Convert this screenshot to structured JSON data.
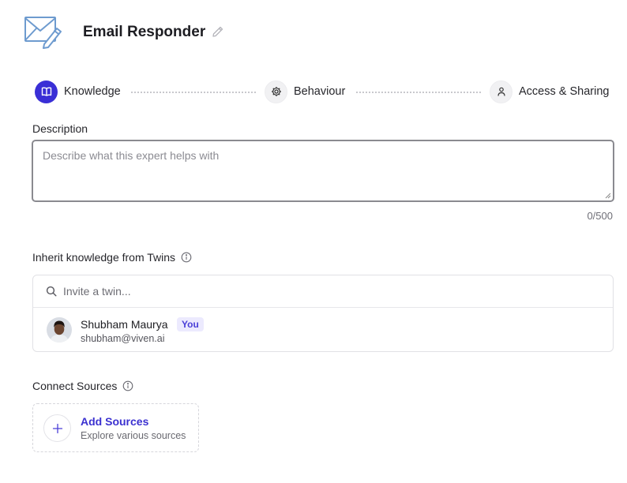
{
  "header": {
    "title": "Email Responder",
    "logo_icon": "envelope-pencil-icon",
    "edit_icon": "pencil-icon"
  },
  "stepper": {
    "steps": [
      {
        "label": "Knowledge",
        "icon": "book-icon",
        "state": "active"
      },
      {
        "label": "Behaviour",
        "icon": "gear-icon",
        "state": "inactive"
      },
      {
        "label": "Access & Sharing",
        "icon": "user-icon",
        "state": "inactive"
      }
    ]
  },
  "description": {
    "label": "Description",
    "placeholder": "Describe what this expert helps with",
    "value": "",
    "char_count": "0/500"
  },
  "inherit": {
    "label": "Inherit knowledge from Twins",
    "search_placeholder": "Invite a twin...",
    "twins": [
      {
        "name": "Shubham Maurya",
        "badge": "You",
        "email": "shubham@viven.ai"
      }
    ]
  },
  "sources": {
    "label": "Connect Sources",
    "add_title": "Add Sources",
    "add_subtitle": "Explore various sources"
  },
  "colors": {
    "accent": "#3a2fd6",
    "badge_bg": "#eceafe",
    "logo_stroke": "#6e9bcf"
  }
}
